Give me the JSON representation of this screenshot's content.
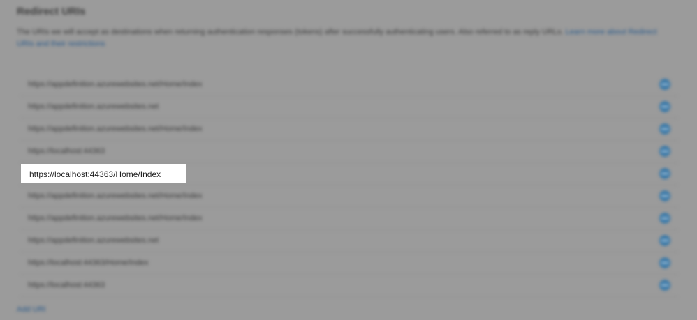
{
  "section": {
    "title": "Redirect URIs",
    "description": "The URIs we will accept as destinations when returning authentication responses (tokens) after successfully authenticating users. Also referred to as reply URLs.",
    "learn_more_link": "Learn more about Redirect URIs and their restrictions"
  },
  "redirect_uris": [
    "https://appdefinition.azurewebsites.net/Home/Index",
    "https://appdefinition.azurewebsites.net",
    "https://appdefinition.azurewebsites.net/Home/Index",
    "https://localhost:44363",
    "https://localhost:44363/Home/Index",
    "https://appdefinition.azurewebsites.net/Home/Index",
    "https://appdefinition.azurewebsites.net/Home/Index",
    "https://appdefinition.azurewebsites.net",
    "https://localhost:44363/Home/Index",
    "https://localhost:44363"
  ],
  "highlighted_uri": "https://localhost:44363/Home/Index",
  "add_uri_label": "Add URI",
  "icons": {
    "row_action": "remove-icon"
  },
  "colors": {
    "overlay": "#9b9b9b",
    "link": "#2a5a8a",
    "icon": "#3d7aa8",
    "highlight_bg": "#ffffff"
  }
}
